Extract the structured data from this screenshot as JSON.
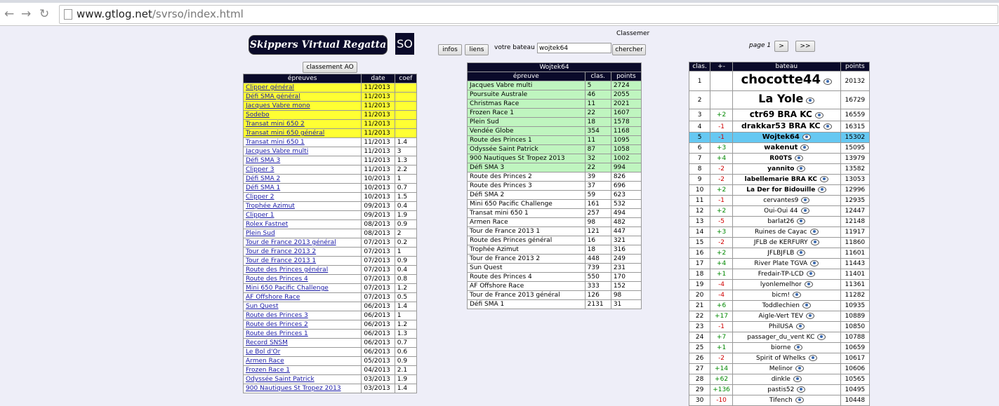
{
  "browser": {
    "url_host": "www.gtlog.net",
    "url_path": "/svrso/index.html"
  },
  "header": {
    "logo_text": "Skippers Virtual Regatta",
    "logo_short": "SO",
    "classement_text": "Classemer",
    "infos_label": "infos",
    "liens_label": "liens",
    "votre_bateau_label": "votre bateau",
    "search_value": "wojtek64",
    "chercher_label": "chercher",
    "page_label": "page 1",
    "next_label": ">",
    "last_label": ">>",
    "classement_ao_label": "classement AO"
  },
  "epreuves": {
    "headers": [
      "épreuves",
      "date",
      "coef"
    ],
    "rows": [
      {
        "name": "Clipper général",
        "date": "11/2013",
        "coef": "",
        "hl": true
      },
      {
        "name": "Défi SMA général",
        "date": "11/2013",
        "coef": "",
        "hl": true
      },
      {
        "name": "Jacques Vabre mono",
        "date": "11/2013",
        "coef": "",
        "hl": true
      },
      {
        "name": "Sodebo",
        "date": "11/2013",
        "coef": "",
        "hl": true
      },
      {
        "name": "Transat mini 650 2",
        "date": "11/2013",
        "coef": "",
        "hl": true
      },
      {
        "name": "Transat mini 650 général",
        "date": "11/2013",
        "coef": "",
        "hl": true
      },
      {
        "name": "Transat mini 650 1",
        "date": "11/2013",
        "coef": "1.4",
        "hl": false
      },
      {
        "name": "Jacques Vabre multi",
        "date": "11/2013",
        "coef": "3",
        "hl": false
      },
      {
        "name": "Défi SMA 3",
        "date": "11/2013",
        "coef": "1.3",
        "hl": false
      },
      {
        "name": "Clipper 3",
        "date": "11/2013",
        "coef": "2.2",
        "hl": false
      },
      {
        "name": "Défi SMA 2",
        "date": "10/2013",
        "coef": "1",
        "hl": false
      },
      {
        "name": "Défi SMA 1",
        "date": "10/2013",
        "coef": "0.7",
        "hl": false
      },
      {
        "name": "Clipper 2",
        "date": "10/2013",
        "coef": "1.5",
        "hl": false
      },
      {
        "name": "Trophée Azimut",
        "date": "09/2013",
        "coef": "0.4",
        "hl": false
      },
      {
        "name": "Clipper 1",
        "date": "09/2013",
        "coef": "1.9",
        "hl": false
      },
      {
        "name": "Rolex Fastnet",
        "date": "08/2013",
        "coef": "0.9",
        "hl": false
      },
      {
        "name": "Plein Sud",
        "date": "08/2013",
        "coef": "2",
        "hl": false
      },
      {
        "name": "Tour de France 2013 général",
        "date": "07/2013",
        "coef": "0.2",
        "hl": false
      },
      {
        "name": "Tour de France 2013 2",
        "date": "07/2013",
        "coef": "1",
        "hl": false
      },
      {
        "name": "Tour de France 2013 1",
        "date": "07/2013",
        "coef": "0.9",
        "hl": false
      },
      {
        "name": "Route des Princes général",
        "date": "07/2013",
        "coef": "0.4",
        "hl": false
      },
      {
        "name": "Route des Princes 4",
        "date": "07/2013",
        "coef": "0.8",
        "hl": false
      },
      {
        "name": "Mini 650 Pacific Challenge",
        "date": "07/2013",
        "coef": "1.2",
        "hl": false
      },
      {
        "name": "AF Offshore Race",
        "date": "07/2013",
        "coef": "0.5",
        "hl": false
      },
      {
        "name": "Sun Quest",
        "date": "06/2013",
        "coef": "1.4",
        "hl": false
      },
      {
        "name": "Route des Princes 3",
        "date": "06/2013",
        "coef": "1",
        "hl": false
      },
      {
        "name": "Route des Princes 2",
        "date": "06/2013",
        "coef": "1.2",
        "hl": false
      },
      {
        "name": "Route des Princes 1",
        "date": "06/2013",
        "coef": "1.3",
        "hl": false
      },
      {
        "name": "Record SNSM",
        "date": "06/2013",
        "coef": "0.7",
        "hl": false
      },
      {
        "name": "Le Bol d'Or",
        "date": "06/2013",
        "coef": "0.6",
        "hl": false
      },
      {
        "name": "Armen Race",
        "date": "05/2013",
        "coef": "0.9",
        "hl": false
      },
      {
        "name": "Frozen Race 1",
        "date": "04/2013",
        "coef": "2.1",
        "hl": false
      },
      {
        "name": "Odyssée Saint Patrick",
        "date": "03/2013",
        "coef": "1.9",
        "hl": false
      },
      {
        "name": "900 Nautiques St Tropez 2013",
        "date": "03/2013",
        "coef": "1.4",
        "hl": false
      }
    ]
  },
  "boat": {
    "title": "Wojtek64",
    "headers": [
      "épreuve",
      "clas.",
      "points"
    ],
    "rows": [
      {
        "name": "Jacques Vabre multi",
        "clas": "5",
        "points": "2724",
        "hl": true
      },
      {
        "name": "Poursuite Australe",
        "clas": "46",
        "points": "2055",
        "hl": true
      },
      {
        "name": "Christmas Race",
        "clas": "11",
        "points": "2021",
        "hl": true
      },
      {
        "name": "Frozen Race 1",
        "clas": "22",
        "points": "1607",
        "hl": true
      },
      {
        "name": "Plein Sud",
        "clas": "18",
        "points": "1578",
        "hl": true
      },
      {
        "name": "Vendée Globe",
        "clas": "354",
        "points": "1168",
        "hl": true
      },
      {
        "name": "Route des Princes 1",
        "clas": "11",
        "points": "1095",
        "hl": true
      },
      {
        "name": "Odyssée Saint Patrick",
        "clas": "87",
        "points": "1058",
        "hl": true
      },
      {
        "name": "900 Nautiques St Tropez 2013",
        "clas": "32",
        "points": "1002",
        "hl": true
      },
      {
        "name": "Défi SMA 3",
        "clas": "22",
        "points": "994",
        "hl": true
      },
      {
        "name": "Route des Princes 2",
        "clas": "39",
        "points": "826",
        "hl": false
      },
      {
        "name": "Route des Princes 3",
        "clas": "37",
        "points": "696",
        "hl": false
      },
      {
        "name": "Défi SMA 2",
        "clas": "59",
        "points": "623",
        "hl": false
      },
      {
        "name": "Mini 650 Pacific Challenge",
        "clas": "161",
        "points": "532",
        "hl": false
      },
      {
        "name": "Transat mini 650 1",
        "clas": "257",
        "points": "494",
        "hl": false
      },
      {
        "name": "Armen Race",
        "clas": "98",
        "points": "482",
        "hl": false
      },
      {
        "name": "Tour de France 2013 1",
        "clas": "121",
        "points": "447",
        "hl": false
      },
      {
        "name": "Route des Princes général",
        "clas": "16",
        "points": "321",
        "hl": false
      },
      {
        "name": "Trophée Azimut",
        "clas": "18",
        "points": "316",
        "hl": false
      },
      {
        "name": "Tour de France 2013 2",
        "clas": "448",
        "points": "249",
        "hl": false
      },
      {
        "name": "Sun Quest",
        "clas": "739",
        "points": "231",
        "hl": false
      },
      {
        "name": "Route des Princes 4",
        "clas": "550",
        "points": "170",
        "hl": false
      },
      {
        "name": "AF Offshore Race",
        "clas": "333",
        "points": "152",
        "hl": false
      },
      {
        "name": "Tour de France 2013 général",
        "clas": "126",
        "points": "98",
        "hl": false
      },
      {
        "name": "Défi SMA 1",
        "clas": "2131",
        "points": "31",
        "hl": false
      }
    ]
  },
  "ranking": {
    "headers": [
      "clas.",
      "+-",
      "bateau",
      "points"
    ],
    "rows": [
      {
        "rank": "1",
        "delta": "",
        "boat": "chocotte44",
        "points": "20132",
        "size": 18,
        "bold": true
      },
      {
        "rank": "2",
        "delta": "",
        "boat": "La Yole",
        "points": "16729",
        "size": 16,
        "bold": true
      },
      {
        "rank": "3",
        "delta": "+2",
        "boat": "ctr69 BRA KC",
        "points": "16559",
        "size": 12,
        "bold": true
      },
      {
        "rank": "4",
        "delta": "-1",
        "boat": "drakkar53 BRA KC",
        "points": "16315",
        "size": 11,
        "bold": true
      },
      {
        "rank": "5",
        "delta": "-1",
        "boat": "Wojtek64",
        "points": "15302",
        "size": 10,
        "bold": true,
        "sel": true
      },
      {
        "rank": "6",
        "delta": "+3",
        "boat": "wakenut",
        "points": "15095",
        "size": 10,
        "bold": true
      },
      {
        "rank": "7",
        "delta": "+4",
        "boat": "R00TS",
        "points": "13979",
        "size": 9,
        "bold": true
      },
      {
        "rank": "8",
        "delta": "-2",
        "boat": "yannito",
        "points": "13582",
        "size": 9,
        "bold": true
      },
      {
        "rank": "9",
        "delta": "-2",
        "boat": "labellemarie BRA KC",
        "points": "13053",
        "size": 9,
        "bold": true
      },
      {
        "rank": "10",
        "delta": "+2",
        "boat": "La Der for Bidouille",
        "points": "12996",
        "size": 9,
        "bold": true
      },
      {
        "rank": "11",
        "delta": "-1",
        "boat": "cervantes9",
        "points": "12935",
        "size": 9,
        "bold": false
      },
      {
        "rank": "12",
        "delta": "+2",
        "boat": "Oui-Oui 44",
        "points": "12447",
        "size": 9,
        "bold": false
      },
      {
        "rank": "13",
        "delta": "-5",
        "boat": "barlat26",
        "points": "12148",
        "size": 9,
        "bold": false
      },
      {
        "rank": "14",
        "delta": "+3",
        "boat": "Ruines de Cayac",
        "points": "11917",
        "size": 9,
        "bold": false
      },
      {
        "rank": "15",
        "delta": "-2",
        "boat": "JFLB de KERFURY",
        "points": "11860",
        "size": 9,
        "bold": false
      },
      {
        "rank": "16",
        "delta": "+2",
        "boat": "JFLBJFLB",
        "points": "11601",
        "size": 9,
        "bold": false
      },
      {
        "rank": "17",
        "delta": "+4",
        "boat": "River Plate TGVA",
        "points": "11443",
        "size": 9,
        "bold": false
      },
      {
        "rank": "18",
        "delta": "+1",
        "boat": "Fredair-TP-LCD",
        "points": "11401",
        "size": 9,
        "bold": false
      },
      {
        "rank": "19",
        "delta": "-4",
        "boat": "lyonlemelhor",
        "points": "11361",
        "size": 9,
        "bold": false
      },
      {
        "rank": "20",
        "delta": "-4",
        "boat": "bicm!",
        "points": "11282",
        "size": 9,
        "bold": false
      },
      {
        "rank": "21",
        "delta": "+6",
        "boat": "Toddlechien",
        "points": "10935",
        "size": 9,
        "bold": false
      },
      {
        "rank": "22",
        "delta": "+17",
        "boat": "Aigle-Vert TEV",
        "points": "10889",
        "size": 9,
        "bold": false
      },
      {
        "rank": "23",
        "delta": "-1",
        "boat": "PhilUSA",
        "points": "10850",
        "size": 9,
        "bold": false
      },
      {
        "rank": "24",
        "delta": "+7",
        "boat": "passager_du_vent KC",
        "points": "10788",
        "size": 9,
        "bold": false
      },
      {
        "rank": "25",
        "delta": "+1",
        "boat": "biorne",
        "points": "10659",
        "size": 9,
        "bold": false
      },
      {
        "rank": "26",
        "delta": "-2",
        "boat": "Spirit of Whelks",
        "points": "10617",
        "size": 9,
        "bold": false
      },
      {
        "rank": "27",
        "delta": "+14",
        "boat": "Melinor",
        "points": "10606",
        "size": 9,
        "bold": false
      },
      {
        "rank": "28",
        "delta": "+62",
        "boat": "dinkle",
        "points": "10565",
        "size": 9,
        "bold": false
      },
      {
        "rank": "29",
        "delta": "+136",
        "boat": "pastis52",
        "points": "10495",
        "size": 9,
        "bold": false
      },
      {
        "rank": "30",
        "delta": "-10",
        "boat": "Tifench",
        "points": "10448",
        "size": 9,
        "bold": false
      }
    ]
  }
}
